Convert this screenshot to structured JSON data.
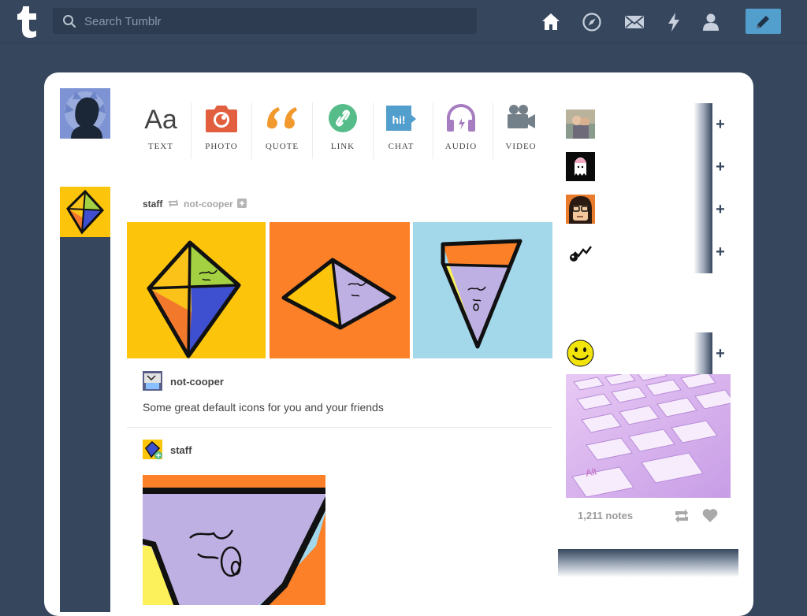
{
  "search": {
    "placeholder": "Search Tumblr"
  },
  "nav": {
    "icons": [
      "home-icon",
      "explore-icon",
      "inbox-icon",
      "activity-icon",
      "account-icon"
    ],
    "compose_icon": "pencil-icon"
  },
  "colors": {
    "background": "#36465d",
    "compose": "#529ecc",
    "text": "#e15e3f",
    "photo": "#e15e3f",
    "quote": "#f2992e",
    "link": "#56bc8a",
    "chat": "#529ecc",
    "audio": "#a77dc2",
    "video": "#748089"
  },
  "post_types": [
    {
      "label": "TEXT",
      "glyph": "Aa"
    },
    {
      "label": "PHOTO"
    },
    {
      "label": "QUOTE"
    },
    {
      "label": "LINK"
    },
    {
      "label": "CHAT",
      "glyph": "hi!"
    },
    {
      "label": "AUDIO"
    },
    {
      "label": "VIDEO"
    }
  ],
  "post": {
    "author": "staff",
    "reblogged_from": "not-cooper",
    "caption_author": "not-cooper",
    "caption": "Some great default icons for you and your friends",
    "next_author": "staff"
  },
  "sidebar": {
    "notes": "1,211 notes",
    "radar_key": "Alt",
    "plus": "+"
  }
}
